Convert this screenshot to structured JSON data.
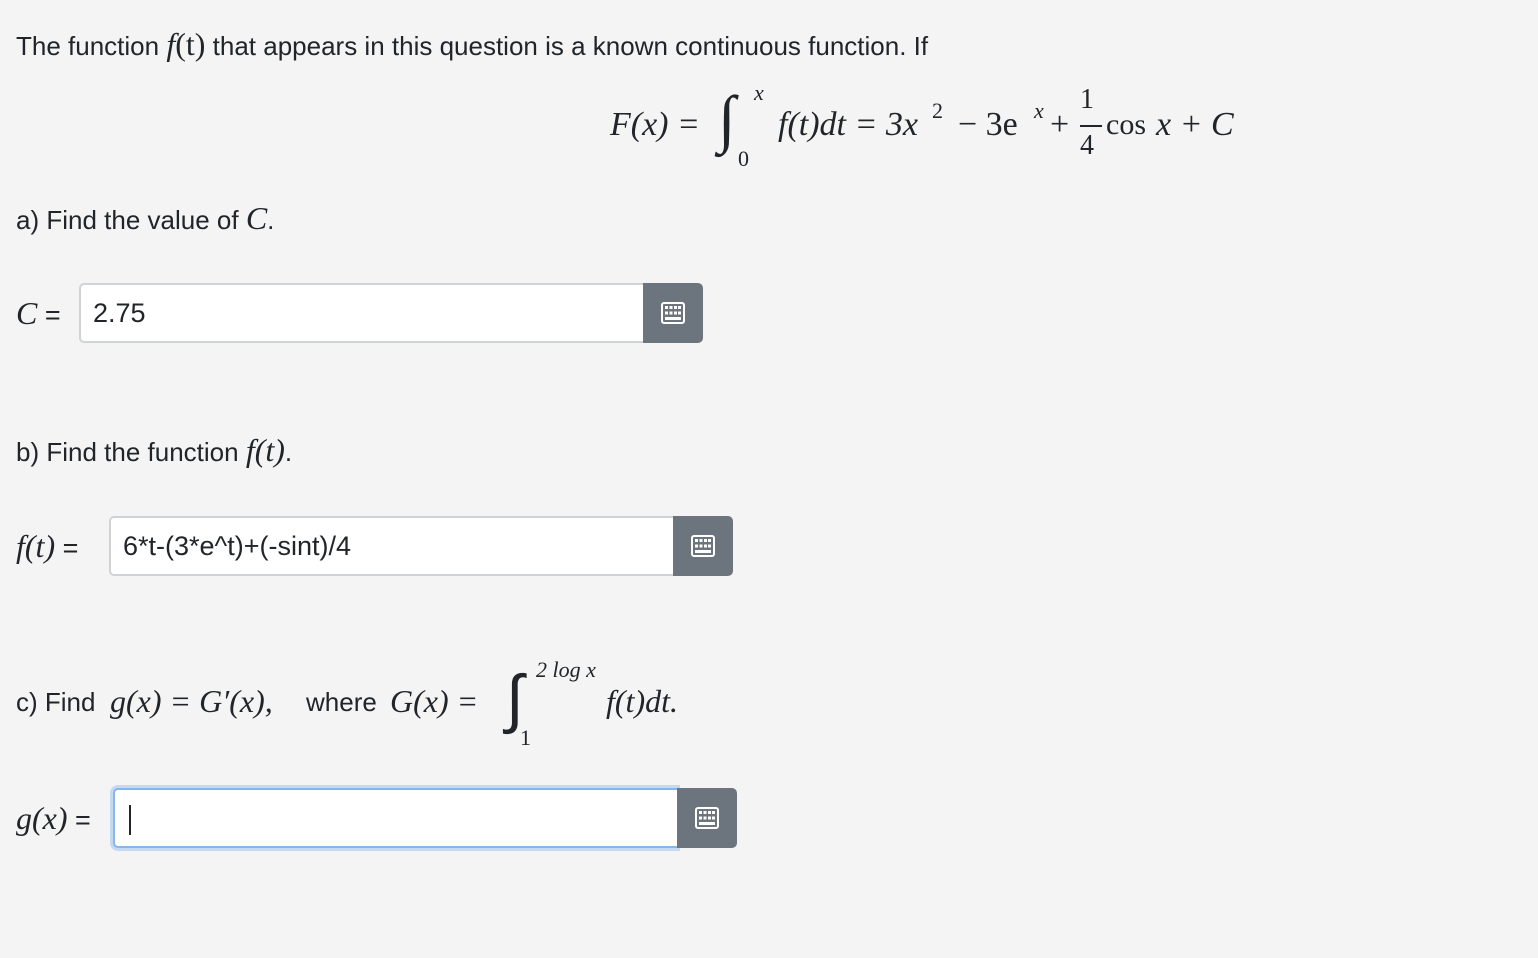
{
  "intro": {
    "text_before": "The function",
    "func_name": "f",
    "func_arg": "(t)",
    "text_after": "that appears in this question is a known continuous function. If"
  },
  "equation": {
    "lhs": "F(x) =",
    "upper_limit": "x",
    "lower_limit": "0",
    "integrand": "f(t)dt = 3x",
    "exp_2": "2",
    "minus_3e": "− 3e",
    "exp_x": "x",
    "plus": "+",
    "frac_num": "1",
    "frac_den": "4",
    "cos_term": "cos",
    "tail": "x + C"
  },
  "part_a": {
    "prompt": "a) Find the value of",
    "var": "C",
    "period": ".",
    "label_var": "C",
    "label_eq": "=",
    "value": "2.75"
  },
  "part_b": {
    "prompt": "b) Find the function",
    "func": "f(t)",
    "period": ".",
    "label_var": "f(t)",
    "label_eq": "=",
    "value": "6*t-(3*e^t)+(-sint)/4"
  },
  "part_c": {
    "prompt": "c) Find",
    "g_def": "g(x) = G′(x),",
    "where": "where",
    "G_def": "G(x) =",
    "upper_limit": "2 log x",
    "lower_limit": "1",
    "integrand": "f(t)dt.",
    "label_var": "g(x)",
    "label_eq": "=",
    "value": ""
  },
  "icons": {
    "keyboard": "keyboard-icon"
  },
  "colors": {
    "background": "#f4f4f4",
    "button": "#6c757d",
    "focus_border": "#86b7ea"
  }
}
